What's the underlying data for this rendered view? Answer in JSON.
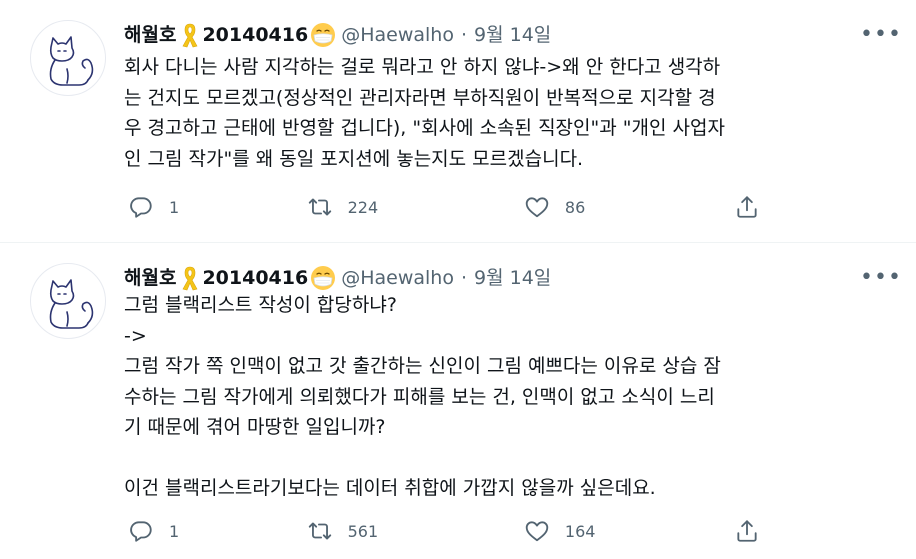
{
  "tweets": [
    {
      "display_name": "해월호",
      "date_tag": "20140416",
      "handle": "@Haewalho",
      "dot": "·",
      "timestamp": "9월 14일",
      "text_lines": [
        "회사 다니는 사람 지각하는 걸로 뭐라고 안 하지 않냐->왜 안 한다고 생각하",
        "는 건지도 모르겠고(정상적인 관리자라면 부하직원이 반복적으로 지각할 경",
        "우 경고하고 근태에 반영할 겁니다), \"회사에 소속된 직장인\"과 \"개인 사업자",
        "인 그림 작가\"를 왜 동일 포지션에 놓는지도 모르겠습니다."
      ],
      "stats": {
        "replies": "1",
        "retweets": "224",
        "likes": "86"
      }
    },
    {
      "display_name": "해월호",
      "date_tag": "20140416",
      "handle": "@Haewalho",
      "dot": "·",
      "timestamp": "9월 14일",
      "text_lines": [
        "그럼 블랙리스트 작성이 합당하냐?",
        "->",
        "그럼 작가 쪽 인맥이 없고 갓 출간하는 신인이 그림 예쁘다는 이유로 상습 잠",
        "수하는 그림 작가에게 의뢰했다가 피해를 보는 건, 인맥이 없고 소식이 느리",
        "기 때문에 겪어 마땅한 일입니까?",
        "",
        "이건 블랙리스트라기보다는 데이터 취합에 가깝지 않을까 싶은데요."
      ],
      "stats": {
        "replies": "1",
        "retweets": "561",
        "likes": "164"
      }
    }
  ],
  "icons": {
    "avatar": "cat-line-drawing-avatar",
    "ribbon": "yellow-ribbon-icon",
    "mask": "face-with-medical-mask-icon",
    "more": "more-options-icon",
    "reply": "reply-icon",
    "retweet": "retweet-icon",
    "like": "like-icon",
    "share": "share-icon"
  },
  "colors": {
    "text": "#0f1419",
    "secondary": "#536471",
    "divider": "#eff3f4",
    "ribbon": "#f5c518",
    "avatar_stroke": "#2c3470"
  }
}
